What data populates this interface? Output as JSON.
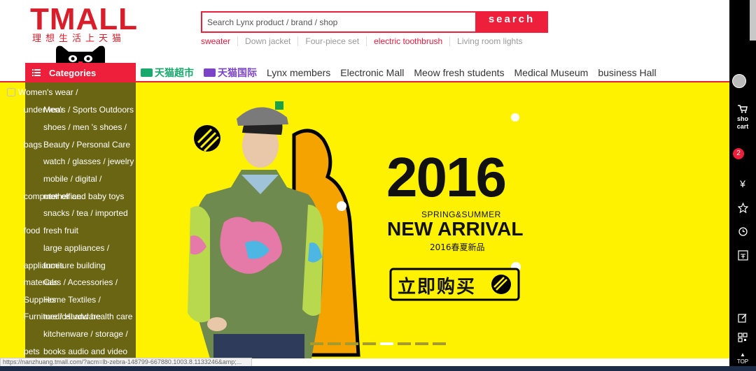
{
  "logo": {
    "main": "TMALL",
    "sub": "理想生活上天猫"
  },
  "search": {
    "placeholder": "Search Lynx product / brand / shop",
    "button_label": "search"
  },
  "hot_words": [
    {
      "label": "sweater",
      "highlight": true
    },
    {
      "label": "Down jacket",
      "highlight": false
    },
    {
      "label": "Four-piece set",
      "highlight": false
    },
    {
      "label": "electric toothbrush",
      "highlight": true
    },
    {
      "label": "Living room lights",
      "highlight": false
    }
  ],
  "categories_tab": {
    "label": "Categories"
  },
  "nav": {
    "super": "天猫超市",
    "intl": "天猫国际",
    "items": [
      "Lynx members",
      "Electronic Mall",
      "Meow fresh students",
      "Medical Museum",
      "business Hall"
    ]
  },
  "categories": [
    "Women's wear /",
    "underwear",
    "Men's / Sports Outdoors",
    "shoes / men 's shoes /",
    "bags",
    "Beauty / Personal Care",
    "watch / glasses / jewelry",
    "mobile / digital /",
    "computer office",
    "mother and baby toys",
    "snacks / tea / imported",
    "food",
    "fresh fruit",
    "large appliances /",
    "appliances",
    "furniture building",
    "materials",
    "Cars / Accessories /",
    "Supplies",
    "Home Textiles /",
    "Furniture / Hardware",
    "medical and health care",
    "kitchenware / storage /",
    "pets",
    "books audio and video"
  ],
  "banner": {
    "year": "2016",
    "season": "SPRING&SUMMER",
    "headline": "NEW ARRIVAL",
    "cn_sub": "2016春夏新品",
    "buy_label": "立即购买"
  },
  "toolbar": {
    "cart_label_1": "sho",
    "cart_label_2": "cart",
    "cart_count": "2",
    "yen": "¥",
    "top_label": "TOP"
  },
  "status_url": "https://nanzhuang.tmall.com/?acm=lb-zebra-148799-667880.1003.8.1133246&amp;...",
  "colors": {
    "brand_red": "#ee1f3a",
    "banner_yellow": "#fff200",
    "super_green": "#17a86c",
    "intl_purple": "#7b43c7"
  }
}
